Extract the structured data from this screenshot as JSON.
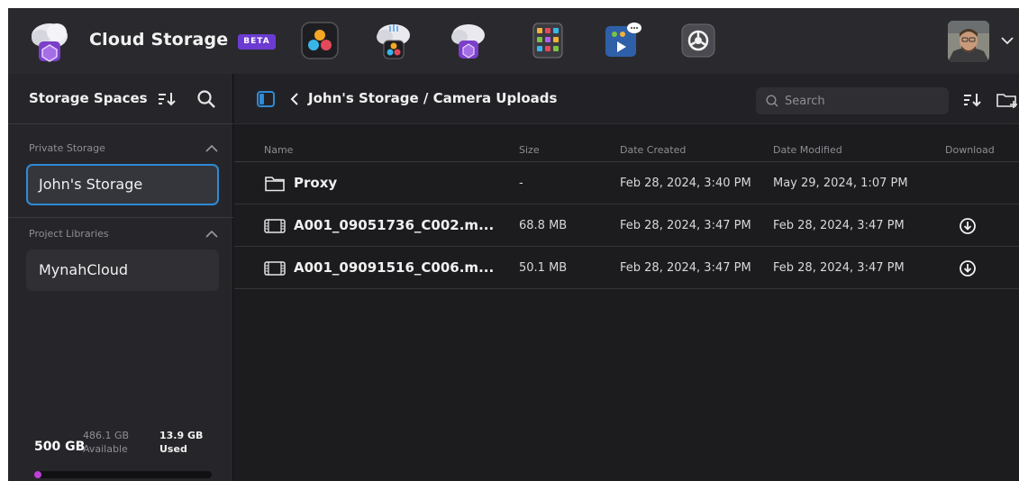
{
  "app": {
    "title": "Cloud Storage",
    "beta_label": "BETA",
    "launcher_icons": [
      "davinci-resolve-icon",
      "cloud-sync-icon",
      "cloud-storage-icon",
      "color-panel-icon",
      "presentations-icon",
      "settings-icon"
    ]
  },
  "sidebar": {
    "title": "Storage Spaces",
    "sections": [
      {
        "label": "Private Storage",
        "items": [
          {
            "label": "John's Storage",
            "selected": true
          }
        ]
      },
      {
        "label": "Project Libraries",
        "items": [
          {
            "label": "MynahCloud",
            "selected": false
          }
        ]
      }
    ],
    "capacity": {
      "total": "500 GB",
      "available_value": "486.1 GB",
      "available_label": "Available",
      "used_value": "13.9 GB",
      "used_label": "Used",
      "used_fraction": 0.028
    }
  },
  "main": {
    "breadcrumb": "John's Storage / Camera Uploads",
    "search": {
      "placeholder": "Search",
      "value": ""
    },
    "columns": {
      "name": "Name",
      "size": "Size",
      "created": "Date Created",
      "modified": "Date Modified",
      "download": "Download"
    },
    "rows": [
      {
        "type": "folder",
        "name": "Proxy",
        "size": "-",
        "created": "Feb 28, 2024, 3:40 PM",
        "modified": "May 29, 2024, 1:07 PM",
        "download": false
      },
      {
        "type": "video",
        "name": "A001_09051736_C002.m...",
        "size": "68.8 MB",
        "created": "Feb 28, 2024, 3:47 PM",
        "modified": "Feb 28, 2024, 3:47 PM",
        "download": true
      },
      {
        "type": "video",
        "name": "A001_09091516_C006.m...",
        "size": "50.1 MB",
        "created": "Feb 28, 2024, 3:47 PM",
        "modified": "Feb 28, 2024, 3:47 PM",
        "download": true
      }
    ]
  },
  "colors": {
    "accent": "#2e8bd6",
    "beta": "#6c3bd1",
    "usage": "#c03fd8"
  }
}
